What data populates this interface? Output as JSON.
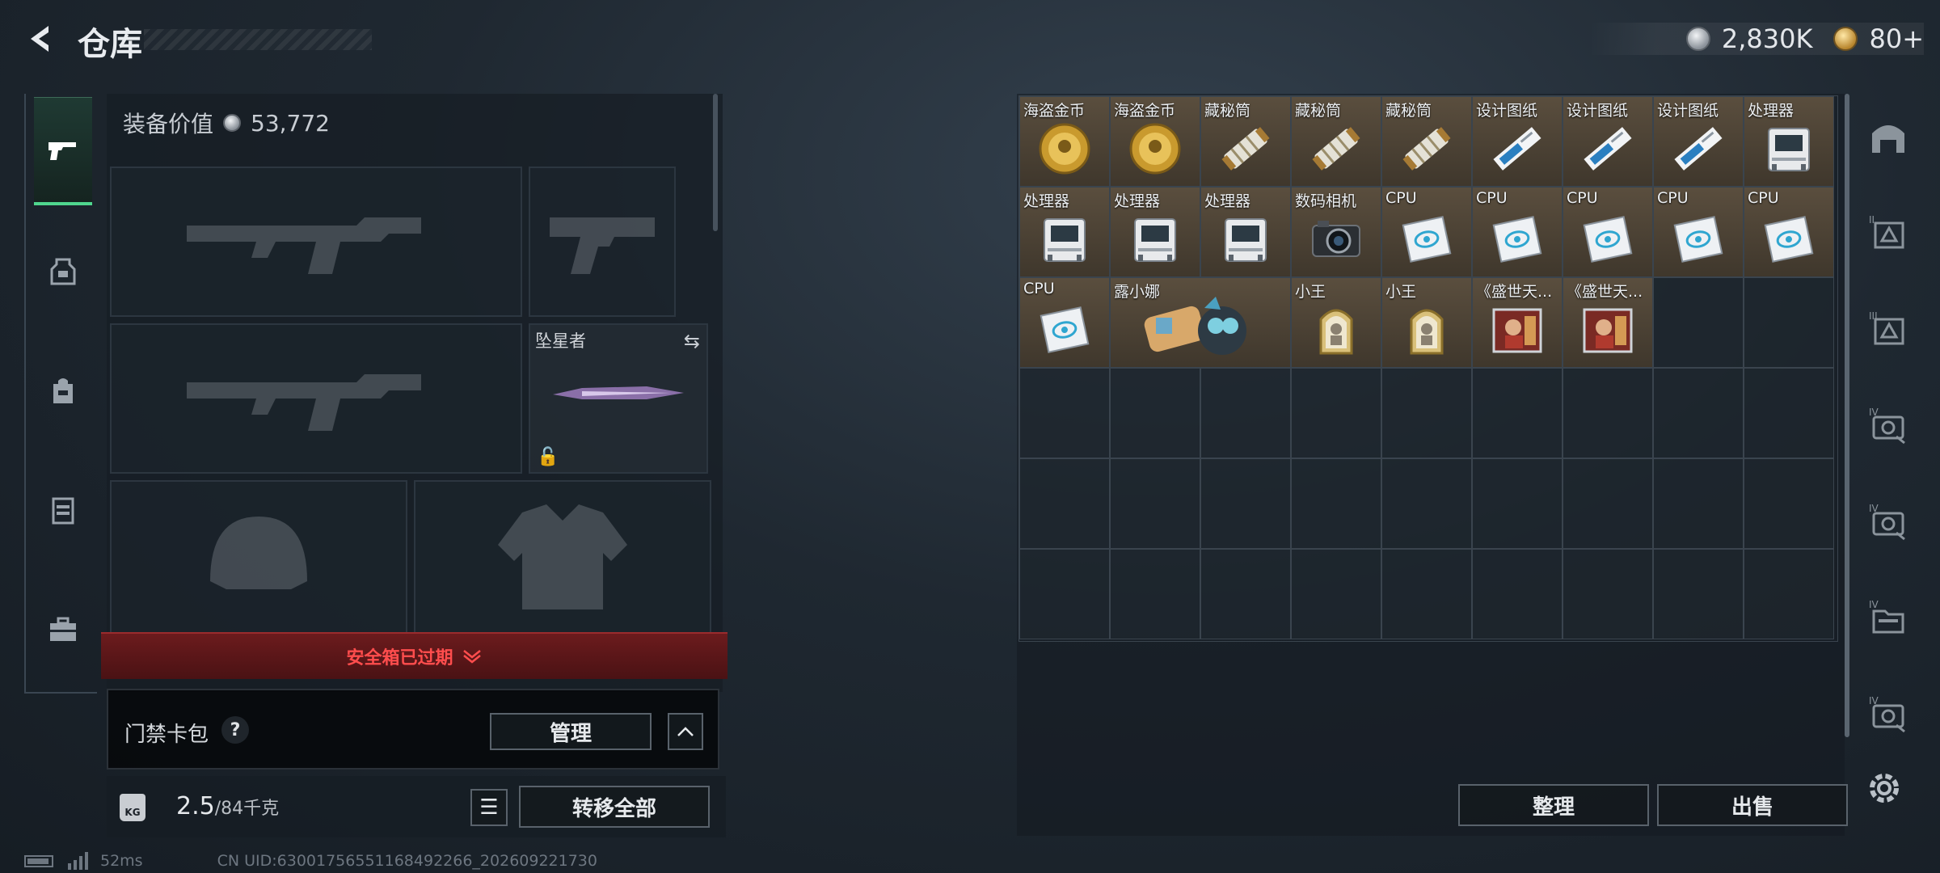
{
  "header": {
    "title": "仓库",
    "currency": [
      {
        "icon": "silver-coin-icon",
        "value": "2,830K"
      },
      {
        "icon": "gold-coin-icon",
        "value": "80+"
      }
    ]
  },
  "left_nav": {
    "items": [
      {
        "icon": "pistol-icon",
        "active": true
      },
      {
        "icon": "backpack-icon",
        "active": false
      },
      {
        "icon": "bag-icon",
        "active": false
      },
      {
        "icon": "vest-icon",
        "active": false
      },
      {
        "icon": "toolbox-icon",
        "active": false
      }
    ]
  },
  "equipment": {
    "value_label": "装备价值",
    "value": "53,772",
    "knife_slot_label": "坠星者",
    "safebox_status": "安全箱已过期"
  },
  "card_bag": {
    "label": "门禁卡包",
    "help": "?",
    "manage_label": "管理",
    "collapse_icon": "chevron-up-icon"
  },
  "weight": {
    "current": "2.5",
    "max": "/84千克",
    "transfer_all_label": "转移全部"
  },
  "status": {
    "ping": "52ms",
    "uid": "CN UID:6300175655116849226​6_202609221730"
  },
  "inventory": {
    "items": [
      {
        "label": "海盗金币",
        "icon": "gold-coin-icon"
      },
      {
        "label": "海盗金币",
        "icon": "gold-coin-icon"
      },
      {
        "label": "藏秘筒",
        "icon": "cryptex-icon"
      },
      {
        "label": "藏秘筒",
        "icon": "cryptex-icon"
      },
      {
        "label": "藏秘筒",
        "icon": "cryptex-icon"
      },
      {
        "label": "设计图纸",
        "icon": "blueprint-icon"
      },
      {
        "label": "设计图纸",
        "icon": "blueprint-icon"
      },
      {
        "label": "设计图纸",
        "icon": "blueprint-icon"
      },
      {
        "label": "处理器",
        "icon": "processor-icon"
      },
      {
        "label": "处理器",
        "icon": "processor-icon"
      },
      {
        "label": "处理器",
        "icon": "processor-icon"
      },
      {
        "label": "处理器",
        "icon": "processor-icon"
      },
      {
        "label": "数码相机",
        "icon": "camera-icon"
      },
      {
        "label": "CPU",
        "icon": "cpu-icon"
      },
      {
        "label": "CPU",
        "icon": "cpu-icon"
      },
      {
        "label": "CPU",
        "icon": "cpu-icon"
      },
      {
        "label": "CPU",
        "icon": "cpu-icon"
      },
      {
        "label": "CPU",
        "icon": "cpu-icon"
      },
      {
        "label": "CPU",
        "icon": "cpu-icon"
      },
      {
        "label": "露小娜",
        "icon": "doll-icon"
      },
      {
        "label": "小王",
        "icon": "card-icon"
      },
      {
        "label": "小王",
        "icon": "card-icon"
      },
      {
        "label": "《盛世天...",
        "icon": "album-icon"
      },
      {
        "label": "《盛世天...",
        "icon": "album-icon"
      }
    ],
    "sort_label": "整理",
    "sell_label": "出售"
  },
  "right_nav": {
    "items": [
      {
        "icon": "stash-home-icon"
      },
      {
        "icon": "tier-2-storage-icon"
      },
      {
        "icon": "tier-3-storage-icon"
      },
      {
        "icon": "tier-4-camera-icon"
      },
      {
        "icon": "tier-4-camera-icon"
      },
      {
        "icon": "tier-4-folder-icon"
      },
      {
        "icon": "tier-4-camera-icon"
      }
    ],
    "settings_icon": "gear-icon"
  },
  "colors": {
    "accent_green": "#4fd68e",
    "warning_red": "#ff4d4d",
    "item_cell": "#5a4e3e"
  }
}
